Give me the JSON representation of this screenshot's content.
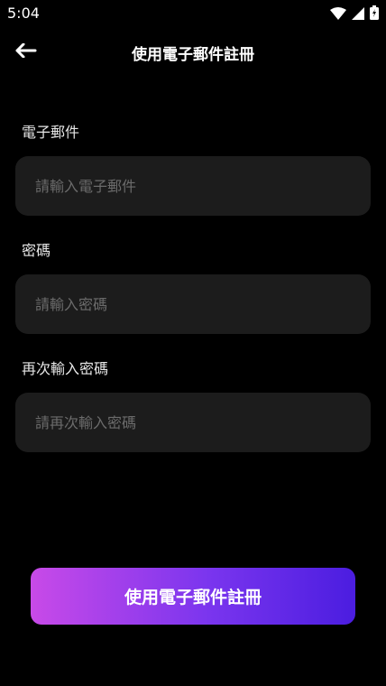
{
  "status_bar": {
    "time": "5:04"
  },
  "header": {
    "title": "使用電子郵件註冊"
  },
  "form": {
    "email": {
      "label": "電子郵件",
      "placeholder": "請輸入電子郵件"
    },
    "password": {
      "label": "密碼",
      "placeholder": "請輸入密碼"
    },
    "confirm_password": {
      "label": "再次輸入密碼",
      "placeholder": "請再次輸入密碼"
    }
  },
  "submit": {
    "label": "使用電子郵件註冊"
  },
  "colors": {
    "background": "#000000",
    "field_bg": "#1c1c1c",
    "gradient_start": "#c84ae8",
    "gradient_end": "#4b1de0"
  }
}
